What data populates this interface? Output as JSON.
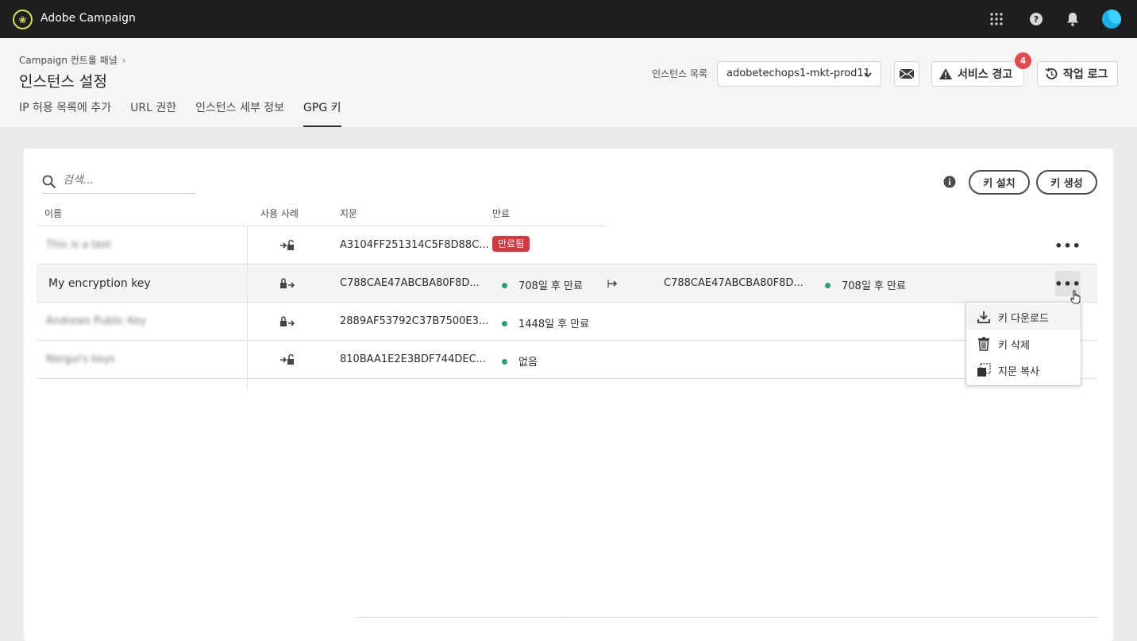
{
  "app": {
    "title": "Adobe Campaign",
    "logo_icon": "adobe-campaign-logo"
  },
  "topbar_icons": [
    "apps-grid-icon",
    "help-icon",
    "bell-icon",
    "avatar"
  ],
  "breadcrumb": {
    "parent": "Campaign 컨트롤 패널",
    "chevron": "›"
  },
  "page_title": "인스턴스 설정",
  "tabs": [
    {
      "label": "IP 허용 목록에 추가"
    },
    {
      "label": "URL 권한"
    },
    {
      "label": "인스턴스 세부 정보"
    },
    {
      "label": "GPG 키",
      "active": true
    }
  ],
  "instance": {
    "label": "인스턴스 목록",
    "selected": "adobetechops1-mkt-prod11"
  },
  "buttons": {
    "service_alert": "서비스 경고",
    "service_alert_count": "4",
    "job_log": "작업 로그",
    "install_key": "키 설치",
    "generate_key": "키 생성"
  },
  "search": {
    "placeholder": "검색..."
  },
  "table": {
    "headers": {
      "name": "이름",
      "use_case": "사용 사례",
      "fingerprint": "지문",
      "expiry": "만료"
    },
    "rows": [
      {
        "name": "This is a test",
        "use_case_icon": "decrypt-key-icon",
        "fingerprint": "A3104FF251314C5F8D88C...",
        "expiry": "만료됨",
        "status": "expired",
        "blurred": true
      },
      {
        "name": "My encryption key",
        "use_case_icon": "encrypt-key-icon",
        "fingerprint": "C788CAE47ABCBA80F8D...",
        "expiry": "708일 후 만료",
        "status": "active",
        "blurred": false,
        "overlay_fingerprint": "C788CAE47ABCBA80F8D...",
        "overlay_expiry": "708일 후 만료"
      },
      {
        "name": "Andrews Public Key",
        "use_case_icon": "encrypt-key-icon",
        "fingerprint": "2889AF53792C37B7500E3...",
        "expiry": "1448일 후 만료",
        "status": "active",
        "blurred": true
      },
      {
        "name": "Nergui's keys",
        "use_case_icon": "decrypt-key-icon",
        "fingerprint": "810BAA1E2E3BDF744DEC...",
        "expiry": "없음",
        "status": "active",
        "blurred": true
      }
    ]
  },
  "context_menu": [
    {
      "label": "키 다운로드",
      "icon": "download-icon"
    },
    {
      "label": "키 삭제",
      "icon": "trash-icon"
    },
    {
      "label": "지문 복사",
      "icon": "copy-icon"
    }
  ],
  "colors": {
    "topbar": "#1e1e1e",
    "accent_badge": "#e34850",
    "status_green": "#2d9d78",
    "expired_red": "#d7373f",
    "avatar": "#1bb1e8"
  }
}
